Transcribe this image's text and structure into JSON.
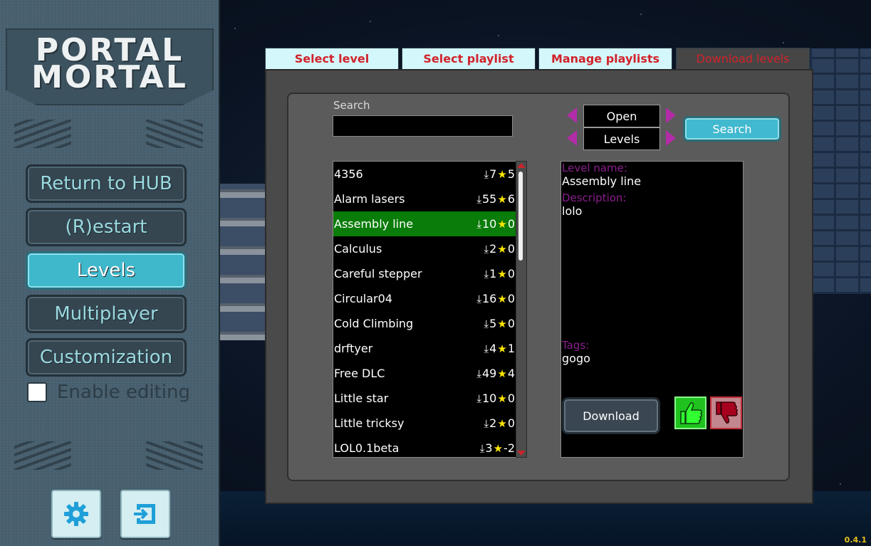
{
  "logo": {
    "line1": "PORTAL",
    "line2": "MORTAL"
  },
  "menu": [
    {
      "label": "Return to HUB"
    },
    {
      "label": "(R)estart"
    },
    {
      "label": "Levels",
      "active": true
    },
    {
      "label": "Multiplayer"
    },
    {
      "label": "Customization"
    }
  ],
  "enable_editing": {
    "label": "Enable editing",
    "checked": false
  },
  "bottom_buttons": {
    "settings_icon": "gear-icon",
    "exit_icon": "exit-icon"
  },
  "tabs": [
    {
      "label": "Select level"
    },
    {
      "label": "Select playlist"
    },
    {
      "label": "Manage playlists"
    },
    {
      "label": "Download levels",
      "active": true
    }
  ],
  "search": {
    "label": "Search",
    "value": "",
    "button_label": "Search"
  },
  "selectors": {
    "open": "Open",
    "levels": "Levels"
  },
  "levels": [
    {
      "name": "4356",
      "downloads": "7",
      "stars": "5"
    },
    {
      "name": "Alarm lasers",
      "downloads": "55",
      "stars": "6"
    },
    {
      "name": "Assembly line",
      "downloads": "10",
      "stars": "0",
      "selected": true
    },
    {
      "name": "Calculus",
      "downloads": "2",
      "stars": "0"
    },
    {
      "name": "Careful stepper",
      "downloads": "1",
      "stars": "0"
    },
    {
      "name": "Circular04",
      "downloads": "16",
      "stars": "0"
    },
    {
      "name": "Cold Climbing",
      "downloads": "5",
      "stars": "0"
    },
    {
      "name": "drftyer",
      "downloads": "4",
      "stars": "1"
    },
    {
      "name": "Free DLC",
      "downloads": "49",
      "stars": "4"
    },
    {
      "name": "Little star",
      "downloads": "10",
      "stars": "0"
    },
    {
      "name": "Little tricksy",
      "downloads": "2",
      "stars": "0"
    },
    {
      "name": "LOL0.1beta",
      "downloads": "3",
      "stars": "-2"
    }
  ],
  "detail": {
    "name_label": "Level name:",
    "name_value": "Assembly line",
    "description_label": "Description:",
    "description_value": "lolo",
    "tags_label": "Tags:",
    "tags_value": "gogo"
  },
  "download_button": "Download",
  "version": "0.4.1",
  "colors": {
    "tab_text": "#d2222a",
    "accent": "#41b9ce",
    "selected_row": "#0a7c0a",
    "label_purple": "#8b1d8e",
    "version": "#e6c21d"
  }
}
